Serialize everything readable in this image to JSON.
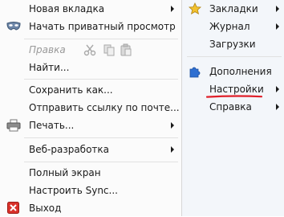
{
  "left_menu": {
    "new_tab": "Новая вкладка",
    "private_browsing": "Начать приватный просмотр",
    "edit": "Правка",
    "find": "Найти...",
    "save_as": "Сохранить как...",
    "send_link": "Отправить ссылку по почте...",
    "print": "Печать...",
    "web_developer": "Веб-разработка",
    "full_screen": "Полный экран",
    "setup_sync": "Настроить Sync...",
    "exit": "Выход"
  },
  "right_menu": {
    "bookmarks": "Закладки",
    "history": "Журнал",
    "downloads": "Загрузки",
    "addons": "Дополнения",
    "options": "Настройки",
    "help": "Справка"
  },
  "icons": {
    "private_browsing": "mask-icon",
    "edit_tools": [
      "cut-icon",
      "copy-icon",
      "paste-icon"
    ],
    "print": "printer-icon",
    "exit": "exit-icon",
    "bookmarks": "star-icon",
    "addons": "puzzle-icon"
  },
  "colors": {
    "highlight_underline": "#e0202a",
    "exit_red": "#d9312a",
    "star_gold": "#f2c12e",
    "addon_blue": "#2e6fd1"
  }
}
